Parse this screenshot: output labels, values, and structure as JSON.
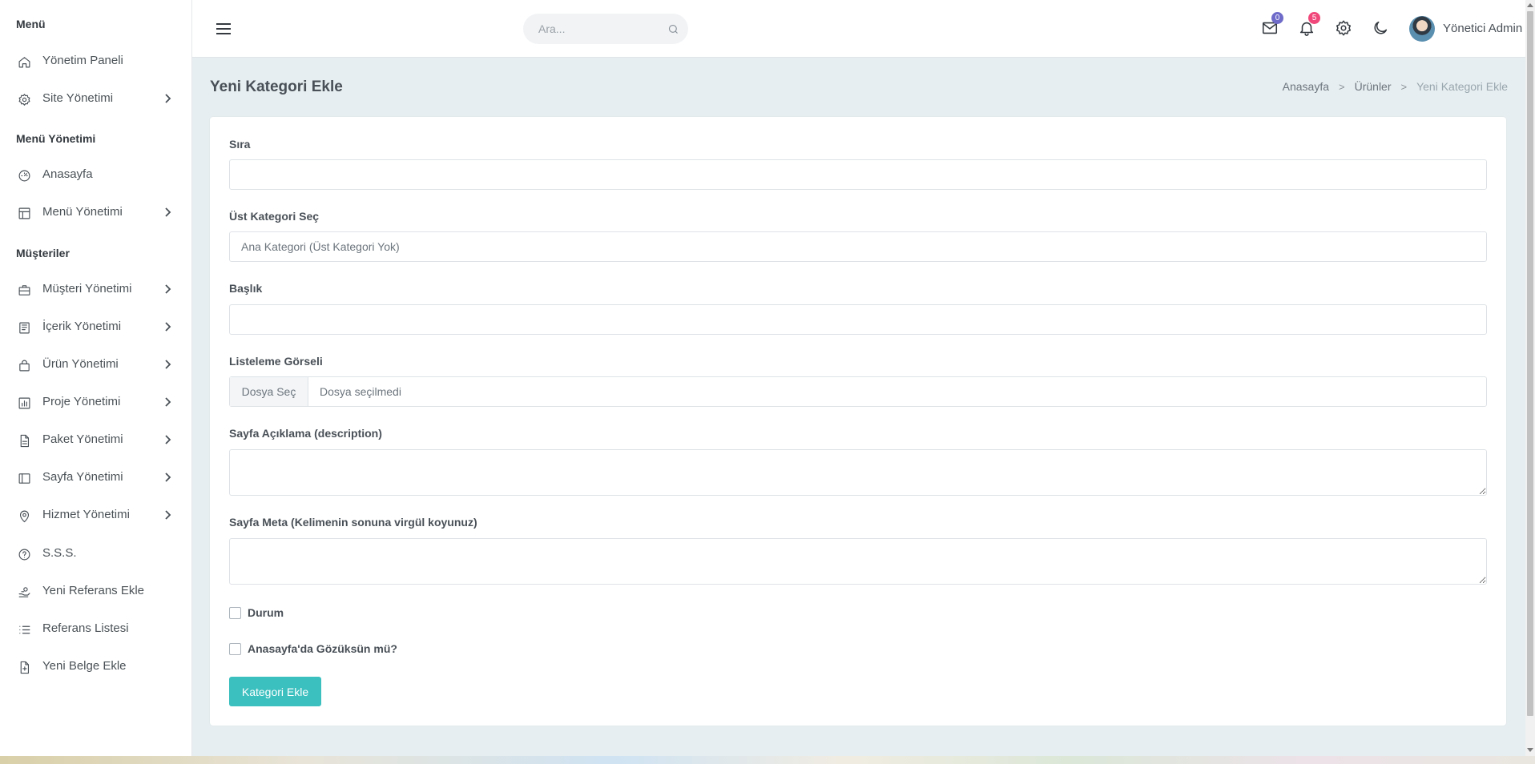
{
  "sidebar": {
    "headers": [
      "Menü",
      "Menü Yönetimi",
      "Müşteriler"
    ],
    "items": [
      {
        "label": "Yönetim Paneli",
        "icon": "home-icon"
      },
      {
        "label": "Site Yönetimi",
        "icon": "gear-icon"
      },
      {
        "label": "Anasayfa",
        "icon": "gauge-icon"
      },
      {
        "label": "Menü Yönetimi",
        "icon": "layout-icon"
      },
      {
        "label": "Müşteri Yönetimi",
        "icon": "briefcase-icon"
      },
      {
        "label": "İçerik Yönetimi",
        "icon": "newspaper-icon"
      },
      {
        "label": "Ürün Yönetimi",
        "icon": "shopping-bag-icon"
      },
      {
        "label": "Proje Yönetimi",
        "icon": "bar-chart-icon"
      },
      {
        "label": "Paket Yönetimi",
        "icon": "file-text-icon"
      },
      {
        "label": "Sayfa Yönetimi",
        "icon": "sidebar-layout-icon"
      },
      {
        "label": "Hizmet Yönetimi",
        "icon": "map-pin-icon"
      },
      {
        "label": "S.S.S.",
        "icon": "help-circle-icon"
      },
      {
        "label": "Yeni Referans Ekle",
        "icon": "hand-coins-icon"
      },
      {
        "label": "Referans Listesi",
        "icon": "list-icon"
      },
      {
        "label": "Yeni Belge Ekle",
        "icon": "file-plus-icon"
      }
    ]
  },
  "topbar": {
    "search_placeholder": "Ara...",
    "mail_badge": "0",
    "notification_badge": "5",
    "user_name": "Yönetici Admin",
    "colors": {
      "mail_badge": "#6f6bc9",
      "notification_badge": "#f0487a"
    }
  },
  "page": {
    "title": "Yeni Kategori Ekle",
    "breadcrumb": [
      "Anasayfa",
      "Ürünler",
      "Yeni Kategori Ekle"
    ]
  },
  "form": {
    "sira_label": "Sıra",
    "ust_kategori_label": "Üst Kategori Seç",
    "ust_kategori_value": "Ana Kategori (Üst Kategori Yok)",
    "baslik_label": "Başlık",
    "gorsel_label": "Listeleme Görseli",
    "file_button": "Dosya Seç",
    "file_status": "Dosya seçilmedi",
    "description_label": "Sayfa Açıklama (description)",
    "meta_label": "Sayfa Meta (Kelimenin sonuna virgül koyunuz)",
    "durum_label": "Durum",
    "anasayfa_label": "Anasayfa'da Gözüksün mü?",
    "submit_label": "Kategori Ekle",
    "accent_color": "#3bbfbf"
  }
}
